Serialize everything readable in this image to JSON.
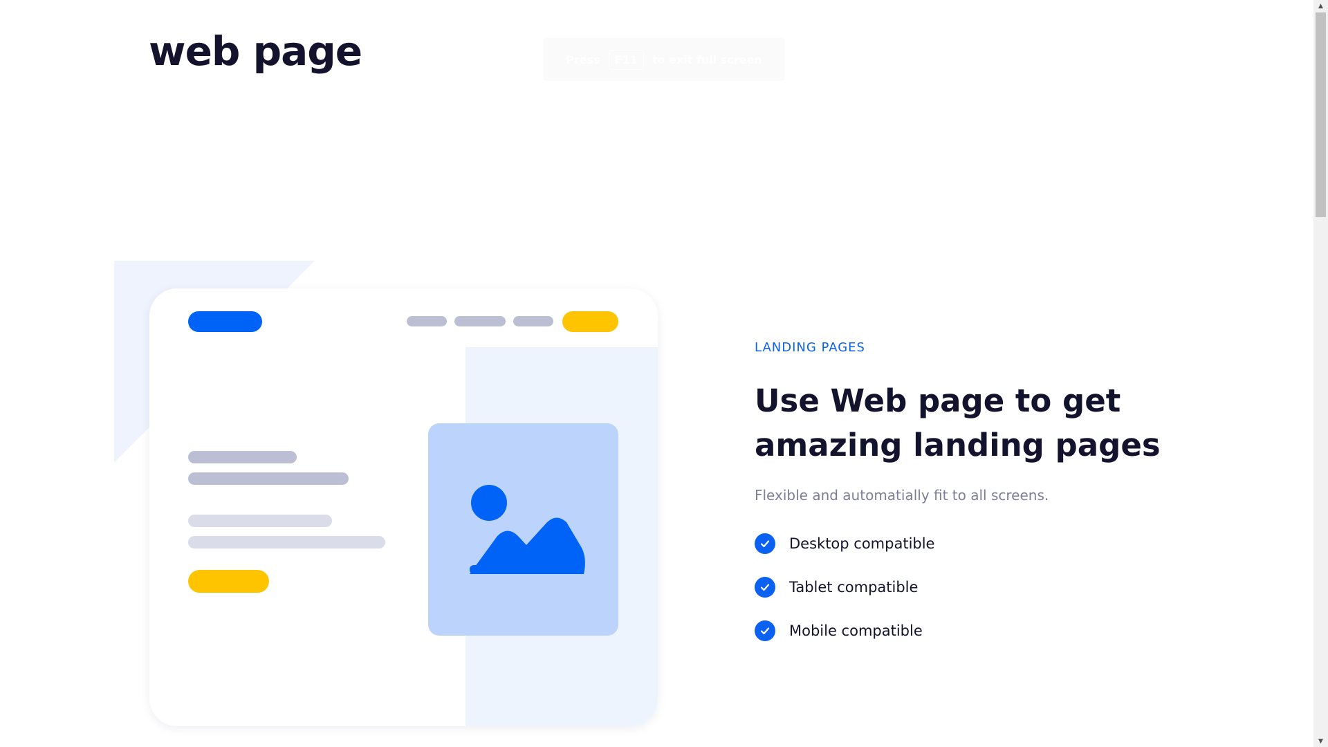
{
  "header": {
    "logo_text": "web page"
  },
  "toast": {
    "prefix": "Press",
    "key": "F11",
    "suffix": "to exit full screen"
  },
  "hero": {
    "eyebrow": "LANDING PAGES",
    "headline": "Use Web page to get amazing landing pages",
    "subtitle": "Flexible and automatially fit to all screens.",
    "features": [
      {
        "label": "Desktop compatible",
        "icon": "check-circle-icon"
      },
      {
        "label": "Tablet compatible",
        "icon": "check-circle-icon"
      },
      {
        "label": "Mobile compatible",
        "icon": "check-circle-icon"
      }
    ]
  },
  "colors": {
    "brand_blue": "#0063f7",
    "accent_yellow": "#ffc400",
    "heading": "#13132d",
    "muted": "#7b7e96",
    "image_card": "#bcd4fb",
    "panel_bg": "#eef4fe"
  }
}
